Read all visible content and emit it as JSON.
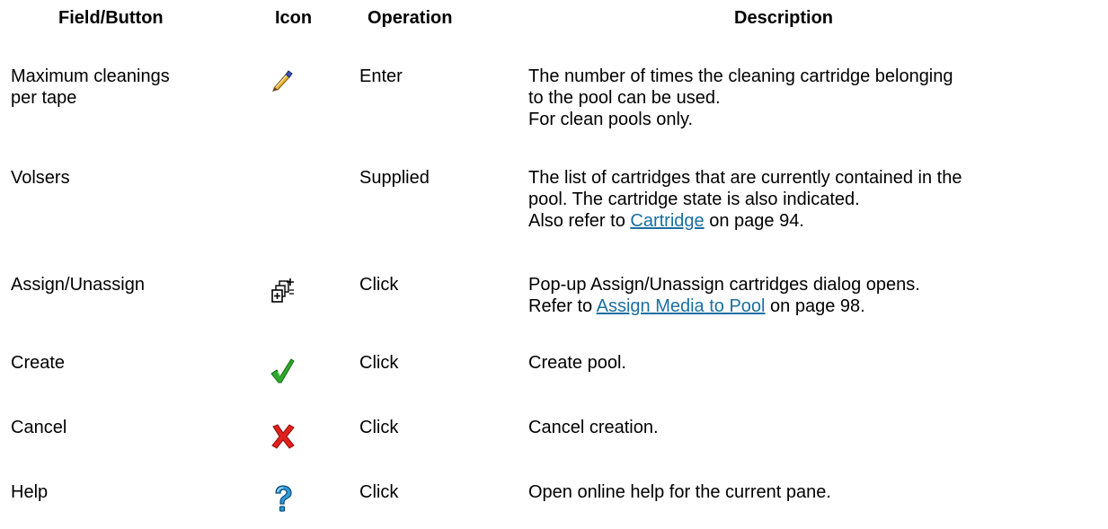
{
  "headers": {
    "field": "Field/Button",
    "icon": "Icon",
    "operation": "Operation",
    "description": "Description"
  },
  "rows": [
    {
      "field": [
        "Maximum cleanings",
        "per tape"
      ],
      "icon": "pen-icon",
      "operation": "Enter",
      "description": [
        "The number of times the cleaning cartridge belonging",
        "to the pool can be used.",
        "For clean pools only."
      ]
    },
    {
      "field": [
        "Volsers"
      ],
      "icon": "",
      "operation": "Supplied",
      "description": [
        "The list of cartridges that are currently contained in the",
        "pool. The cartridge state is also indicated."
      ],
      "ref": {
        "prefix": "Also refer to ",
        "link": "Cartridge",
        "suffix": " on page 94."
      }
    },
    {
      "field": [
        "Assign/Unassign"
      ],
      "icon": "assign-cartridges-icon",
      "operation": "Click",
      "description": [
        "Pop-up Assign/Unassign cartridges dialog opens."
      ],
      "ref": {
        "prefix": "Refer to ",
        "link": "Assign Media to Pool",
        "suffix": " on page 98."
      }
    },
    {
      "field": [
        "Create"
      ],
      "icon": "checkmark-icon",
      "operation": "Click",
      "description": [
        "Create pool."
      ]
    },
    {
      "field": [
        "Cancel"
      ],
      "icon": "red-x-icon",
      "operation": "Click",
      "description": [
        "Cancel creation."
      ]
    },
    {
      "field": [
        "Help"
      ],
      "icon": "question-mark-icon",
      "operation": "Click",
      "description": [
        "Open online help for the current pane."
      ]
    }
  ],
  "colors": {
    "link": "#1a6fa0",
    "check": "#2ea82e",
    "cross": "#e0201c",
    "help": "#2f9ad8"
  }
}
